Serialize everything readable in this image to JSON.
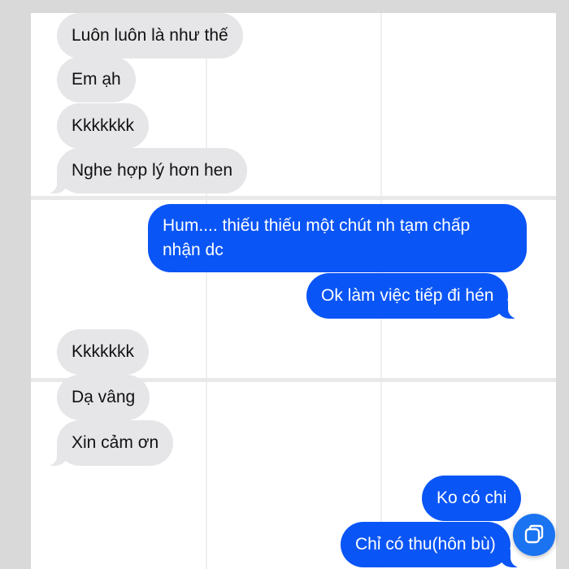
{
  "messages": [
    {
      "side": "in",
      "text": "Luôn luôn là như thế"
    },
    {
      "side": "in",
      "text": "Em ạh"
    },
    {
      "side": "in",
      "text": "Kkkkkkk"
    },
    {
      "side": "in",
      "text": "Nghe hợp lý hơn hen"
    },
    {
      "side": "out",
      "text": "Hum.... thiếu thiếu một chút nh tạm chấp nhận dc"
    },
    {
      "side": "out",
      "text": "Ok làm việc tiếp đi hén"
    },
    {
      "side": "in",
      "text": "Kkkkkkk"
    },
    {
      "side": "in",
      "text": "Dạ vâng"
    },
    {
      "side": "in",
      "text": "Xin cảm ơn"
    },
    {
      "side": "out",
      "text": "Ko có chi"
    },
    {
      "side": "out",
      "text": "Chỉ có thu(hôn bù)"
    }
  ],
  "colors": {
    "incoming_bubble": "#e6e6e9",
    "outgoing_bubble": "#0a55f5",
    "floating_button": "#1a73f0"
  },
  "floating_button": {
    "icon": "copy-icon"
  }
}
